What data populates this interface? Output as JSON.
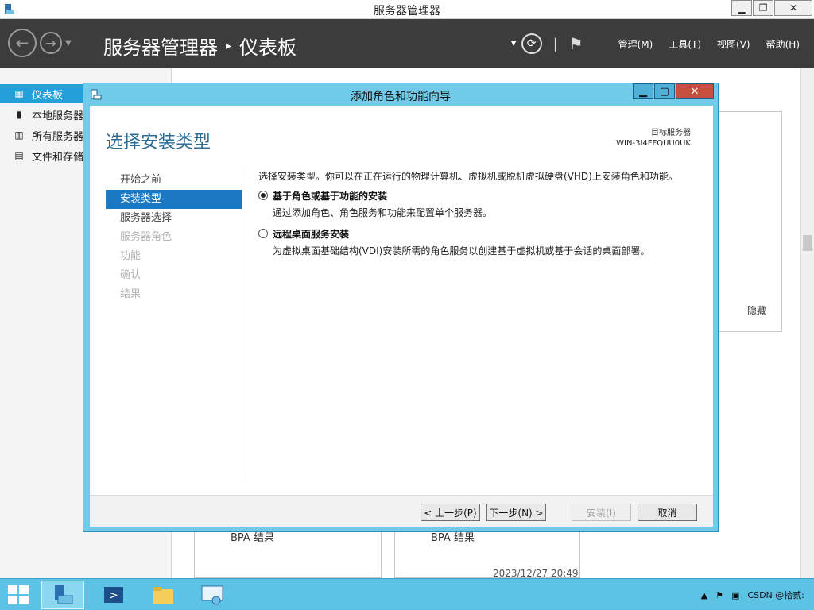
{
  "window": {
    "title": "服务器管理器"
  },
  "header": {
    "breadcrumb_root": "服务器管理器",
    "breadcrumb_sep": "▸",
    "breadcrumb_current": "仪表板",
    "menu": [
      "管理(M)",
      "工具(T)",
      "视图(V)",
      "帮助(H)"
    ]
  },
  "sidebar": {
    "items": [
      {
        "label": "仪表板",
        "icon": "dashboard-icon"
      },
      {
        "label": "本地服务器",
        "icon": "server-icon"
      },
      {
        "label": "所有服务器",
        "icon": "servers-icon"
      },
      {
        "label": "文件和存储",
        "icon": "storage-icon"
      }
    ]
  },
  "background": {
    "hide_label": "隐藏",
    "bpa_1": "BPA 结果",
    "bpa_2": "BPA 结果",
    "timestamp": "2023/12/27 20:49"
  },
  "dialog": {
    "title": "添加角色和功能向导",
    "heading": "选择安装类型",
    "target_label": "目标服务器",
    "target_name": "WIN-3I4FFQUU0UK",
    "steps": [
      {
        "label": "开始之前",
        "state": "normal"
      },
      {
        "label": "安装类型",
        "state": "active"
      },
      {
        "label": "服务器选择",
        "state": "normal"
      },
      {
        "label": "服务器角色",
        "state": "disabled"
      },
      {
        "label": "功能",
        "state": "disabled"
      },
      {
        "label": "确认",
        "state": "disabled"
      },
      {
        "label": "结果",
        "state": "disabled"
      }
    ],
    "intro": "选择安装类型。你可以在正在运行的物理计算机、虚拟机或脱机虚拟硬盘(VHD)上安装角色和功能。",
    "options": [
      {
        "title": "基于角色或基于功能的安装",
        "desc": "通过添加角色、角色服务和功能来配置单个服务器。",
        "selected": true
      },
      {
        "title": "远程桌面服务安装",
        "desc": "为虚拟桌面基础结构(VDI)安装所需的角色服务以创建基于虚拟机或基于会话的桌面部署。",
        "selected": false
      }
    ],
    "buttons": {
      "previous": "< 上一步(P)",
      "next": "下一步(N) >",
      "install": "安装(I)",
      "cancel": "取消"
    }
  },
  "taskbar": {
    "tray_text": "CSDN @拾贰:"
  },
  "colors": {
    "header_bg": "#3c3c3c",
    "accent": "#26a0da",
    "dialog_frame": "#6fcbe8",
    "taskbar": "#5cc3e5",
    "close_red": "#c74f3e"
  }
}
